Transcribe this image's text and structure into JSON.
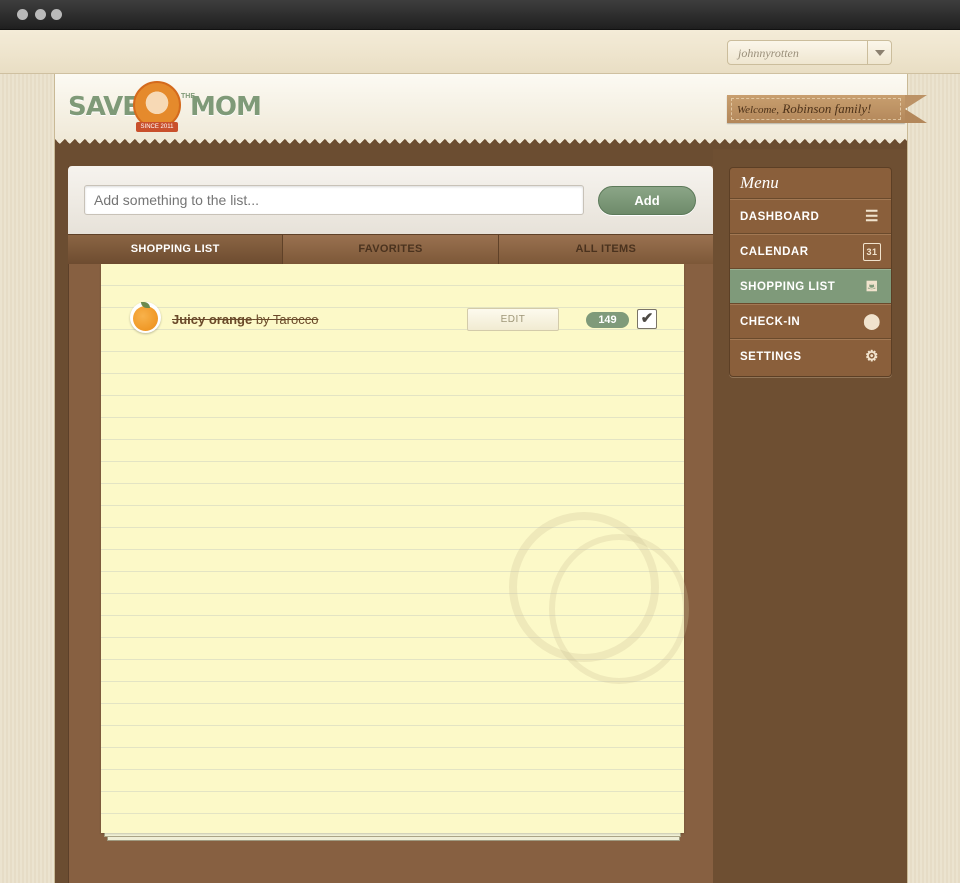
{
  "window": {
    "dots": 3
  },
  "user_select": {
    "value": "johnnyrotten"
  },
  "header": {
    "logo": {
      "word1": "SAVE",
      "the": "THE",
      "word2": "MOM",
      "ribbon": "SINCE 2011"
    },
    "welcome_prefix": "Welcome,",
    "welcome_name": "Robinson family!"
  },
  "addbar": {
    "placeholder": "Add something to the list...",
    "add_label": "Add"
  },
  "tabs": [
    {
      "label": "Shopping list",
      "active": true
    },
    {
      "label": "Favorites",
      "active": false
    },
    {
      "label": "All items",
      "active": false
    }
  ],
  "items": [
    {
      "name": "Juicy orange",
      "brand": "by Tarocco",
      "edit_label": "EDIT",
      "count": "149",
      "checked": true,
      "icon": "orange-icon"
    }
  ],
  "menu": {
    "title": "Menu",
    "items": [
      {
        "label": "Dashboard",
        "icon": "list-icon",
        "active": false
      },
      {
        "label": "Calendar",
        "icon": "calendar-icon",
        "active": false
      },
      {
        "label": "Shopping list",
        "icon": "basket-icon",
        "active": true
      },
      {
        "label": "Check-in",
        "icon": "location-pin-icon",
        "active": false
      },
      {
        "label": "Settings",
        "icon": "gear-icon",
        "active": false
      }
    ]
  },
  "colors": {
    "brown": "#6b4d31",
    "accent_green": "#7f9a7a",
    "paper": "#fcf9c8"
  }
}
